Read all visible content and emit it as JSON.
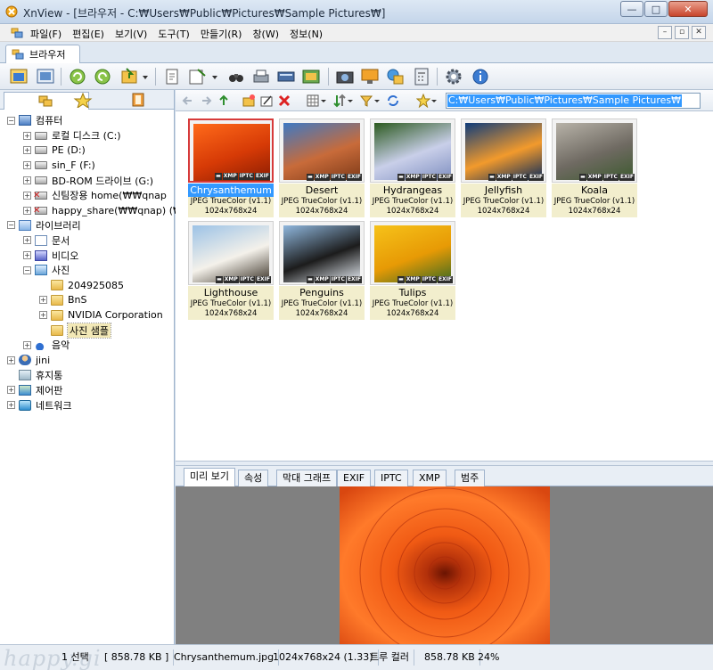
{
  "window": {
    "title": "XnView - [브라우저 - C:₩Users₩Public₩Pictures₩Sample Pictures₩]",
    "minimize": "—",
    "maximize": "□",
    "close": "✕"
  },
  "menu": {
    "items": [
      "파일(F)",
      "편집(E)",
      "보기(V)",
      "도구(T)",
      "만들기(R)",
      "창(W)",
      "정보(N)"
    ],
    "mdi": [
      "–",
      "▫",
      "✕"
    ]
  },
  "tab": {
    "label": "브라우저"
  },
  "toolbar": {
    "icons": [
      "browser-icon",
      "fullscreen-icon",
      "refresh-left-icon",
      "refresh-right-icon",
      "import-icon",
      "dropdown-icon",
      "new-file-icon",
      "export-icon",
      "binoculars-icon",
      "print-icon",
      "scanner-icon",
      "slideshow-icon",
      "camera-icon",
      "screen-icon",
      "web-icon",
      "calculator-icon",
      "settings-icon",
      "info-icon"
    ]
  },
  "tree": {
    "nodes": [
      {
        "label": "컴퓨터",
        "level": 0,
        "icon": "computer",
        "expand": "−"
      },
      {
        "label": "로컬 디스크 (C:)",
        "level": 1,
        "icon": "drive",
        "expand": "+"
      },
      {
        "label": "PE (D:)",
        "level": 1,
        "icon": "drive",
        "expand": "+"
      },
      {
        "label": "sin_F (F:)",
        "level": 1,
        "icon": "drive",
        "expand": "+"
      },
      {
        "label": "BD-ROM 드라이브 (G:)",
        "level": 1,
        "icon": "drive",
        "expand": "+"
      },
      {
        "label": "신팀장용 home(₩₩qnap",
        "level": 1,
        "icon": "netdrive",
        "expand": "+"
      },
      {
        "label": "happy_share(₩₩qnap) (₩",
        "level": 1,
        "icon": "netdrive",
        "expand": "+"
      },
      {
        "label": "라이브러리",
        "level": 0,
        "icon": "lib",
        "expand": "−"
      },
      {
        "label": "문서",
        "level": 1,
        "icon": "doc",
        "expand": "+"
      },
      {
        "label": "비디오",
        "level": 1,
        "icon": "video",
        "expand": "+"
      },
      {
        "label": "사진",
        "level": 1,
        "icon": "photo",
        "expand": "−"
      },
      {
        "label": "204925085",
        "level": 2,
        "icon": "folder",
        "expand": ""
      },
      {
        "label": "BnS",
        "level": 2,
        "icon": "folder",
        "expand": "+"
      },
      {
        "label": "NVIDIA Corporation",
        "level": 2,
        "icon": "folder",
        "expand": "+"
      },
      {
        "label": "사진 샘플",
        "level": 2,
        "icon": "folder",
        "expand": "",
        "selected": true
      },
      {
        "label": "음악",
        "level": 1,
        "icon": "music",
        "expand": "+"
      },
      {
        "label": "jini",
        "level": 0,
        "icon": "user",
        "expand": "+"
      },
      {
        "label": "휴지통",
        "level": 0,
        "icon": "trash",
        "expand": ""
      },
      {
        "label": "제어판",
        "level": 0,
        "icon": "control",
        "expand": "+"
      },
      {
        "label": "네트워크",
        "level": 0,
        "icon": "network",
        "expand": "+"
      }
    ]
  },
  "nav": {
    "path": "C:₩Users₩Public₩Pictures₩Sample Pictures₩"
  },
  "badges": [
    "▬",
    "XMP",
    "IPTC",
    "EXIF"
  ],
  "thumbnails": [
    {
      "name": "Chrysanthemum",
      "type": "JPEG TrueColor (v1.1)",
      "dims": "1024x768x24",
      "selected": true,
      "colors": [
        "#ff6a1a",
        "#d63a06",
        "#8a1d02"
      ]
    },
    {
      "name": "Desert",
      "type": "JPEG TrueColor (v1.1)",
      "dims": "1024x768x24",
      "colors": [
        "#3e79c4",
        "#c86b3a",
        "#7e3a18"
      ]
    },
    {
      "name": "Hydrangeas",
      "type": "JPEG TrueColor (v1.1)",
      "dims": "1024x768x24",
      "colors": [
        "#2c5a1f",
        "#c9cfe9",
        "#7f8fc0"
      ]
    },
    {
      "name": "Jellyfish",
      "type": "JPEG TrueColor (v1.1)",
      "dims": "1024x768x24",
      "colors": [
        "#0f3c7a",
        "#f29a2c",
        "#0a2a5a"
      ]
    },
    {
      "name": "Koala",
      "type": "JPEG TrueColor (v1.1)",
      "dims": "1024x768x24",
      "colors": [
        "#b7b2a8",
        "#6f6a62",
        "#3d5a2f"
      ]
    },
    {
      "name": "Lighthouse",
      "type": "JPEG TrueColor (v1.1)",
      "dims": "1024x768x24",
      "colors": [
        "#9cc2e6",
        "#f4f1ea",
        "#3a3227"
      ]
    },
    {
      "name": "Penguins",
      "type": "JPEG TrueColor (v1.1)",
      "dims": "1024x768x24",
      "colors": [
        "#8fb7dd",
        "#1c1c1c",
        "#e8eef5"
      ]
    },
    {
      "name": "Tulips",
      "type": "JPEG TrueColor (v1.1)",
      "dims": "1024x768x24",
      "colors": [
        "#f6c21a",
        "#e79a05",
        "#3b6a22"
      ]
    }
  ],
  "preview_tabs": [
    "미리 보기",
    "속성",
    "막대 그래프",
    "EXIF",
    "IPTC",
    "XMP",
    "범주"
  ],
  "status": {
    "selection": "1 선택",
    "selection_size": "[ 858.78 KB ]",
    "filename": "Chrysanthemum.jpg",
    "dimensions": "1024x768x24 (1.33)",
    "color_mode": "트루 컬러",
    "file_size": "858.78 KB",
    "zoom": "24%",
    "watermark": "happy.gi"
  },
  "colors": {
    "accent": "#3399ff",
    "label_bg": "#f2eecd",
    "preview_bg": "#808080"
  }
}
